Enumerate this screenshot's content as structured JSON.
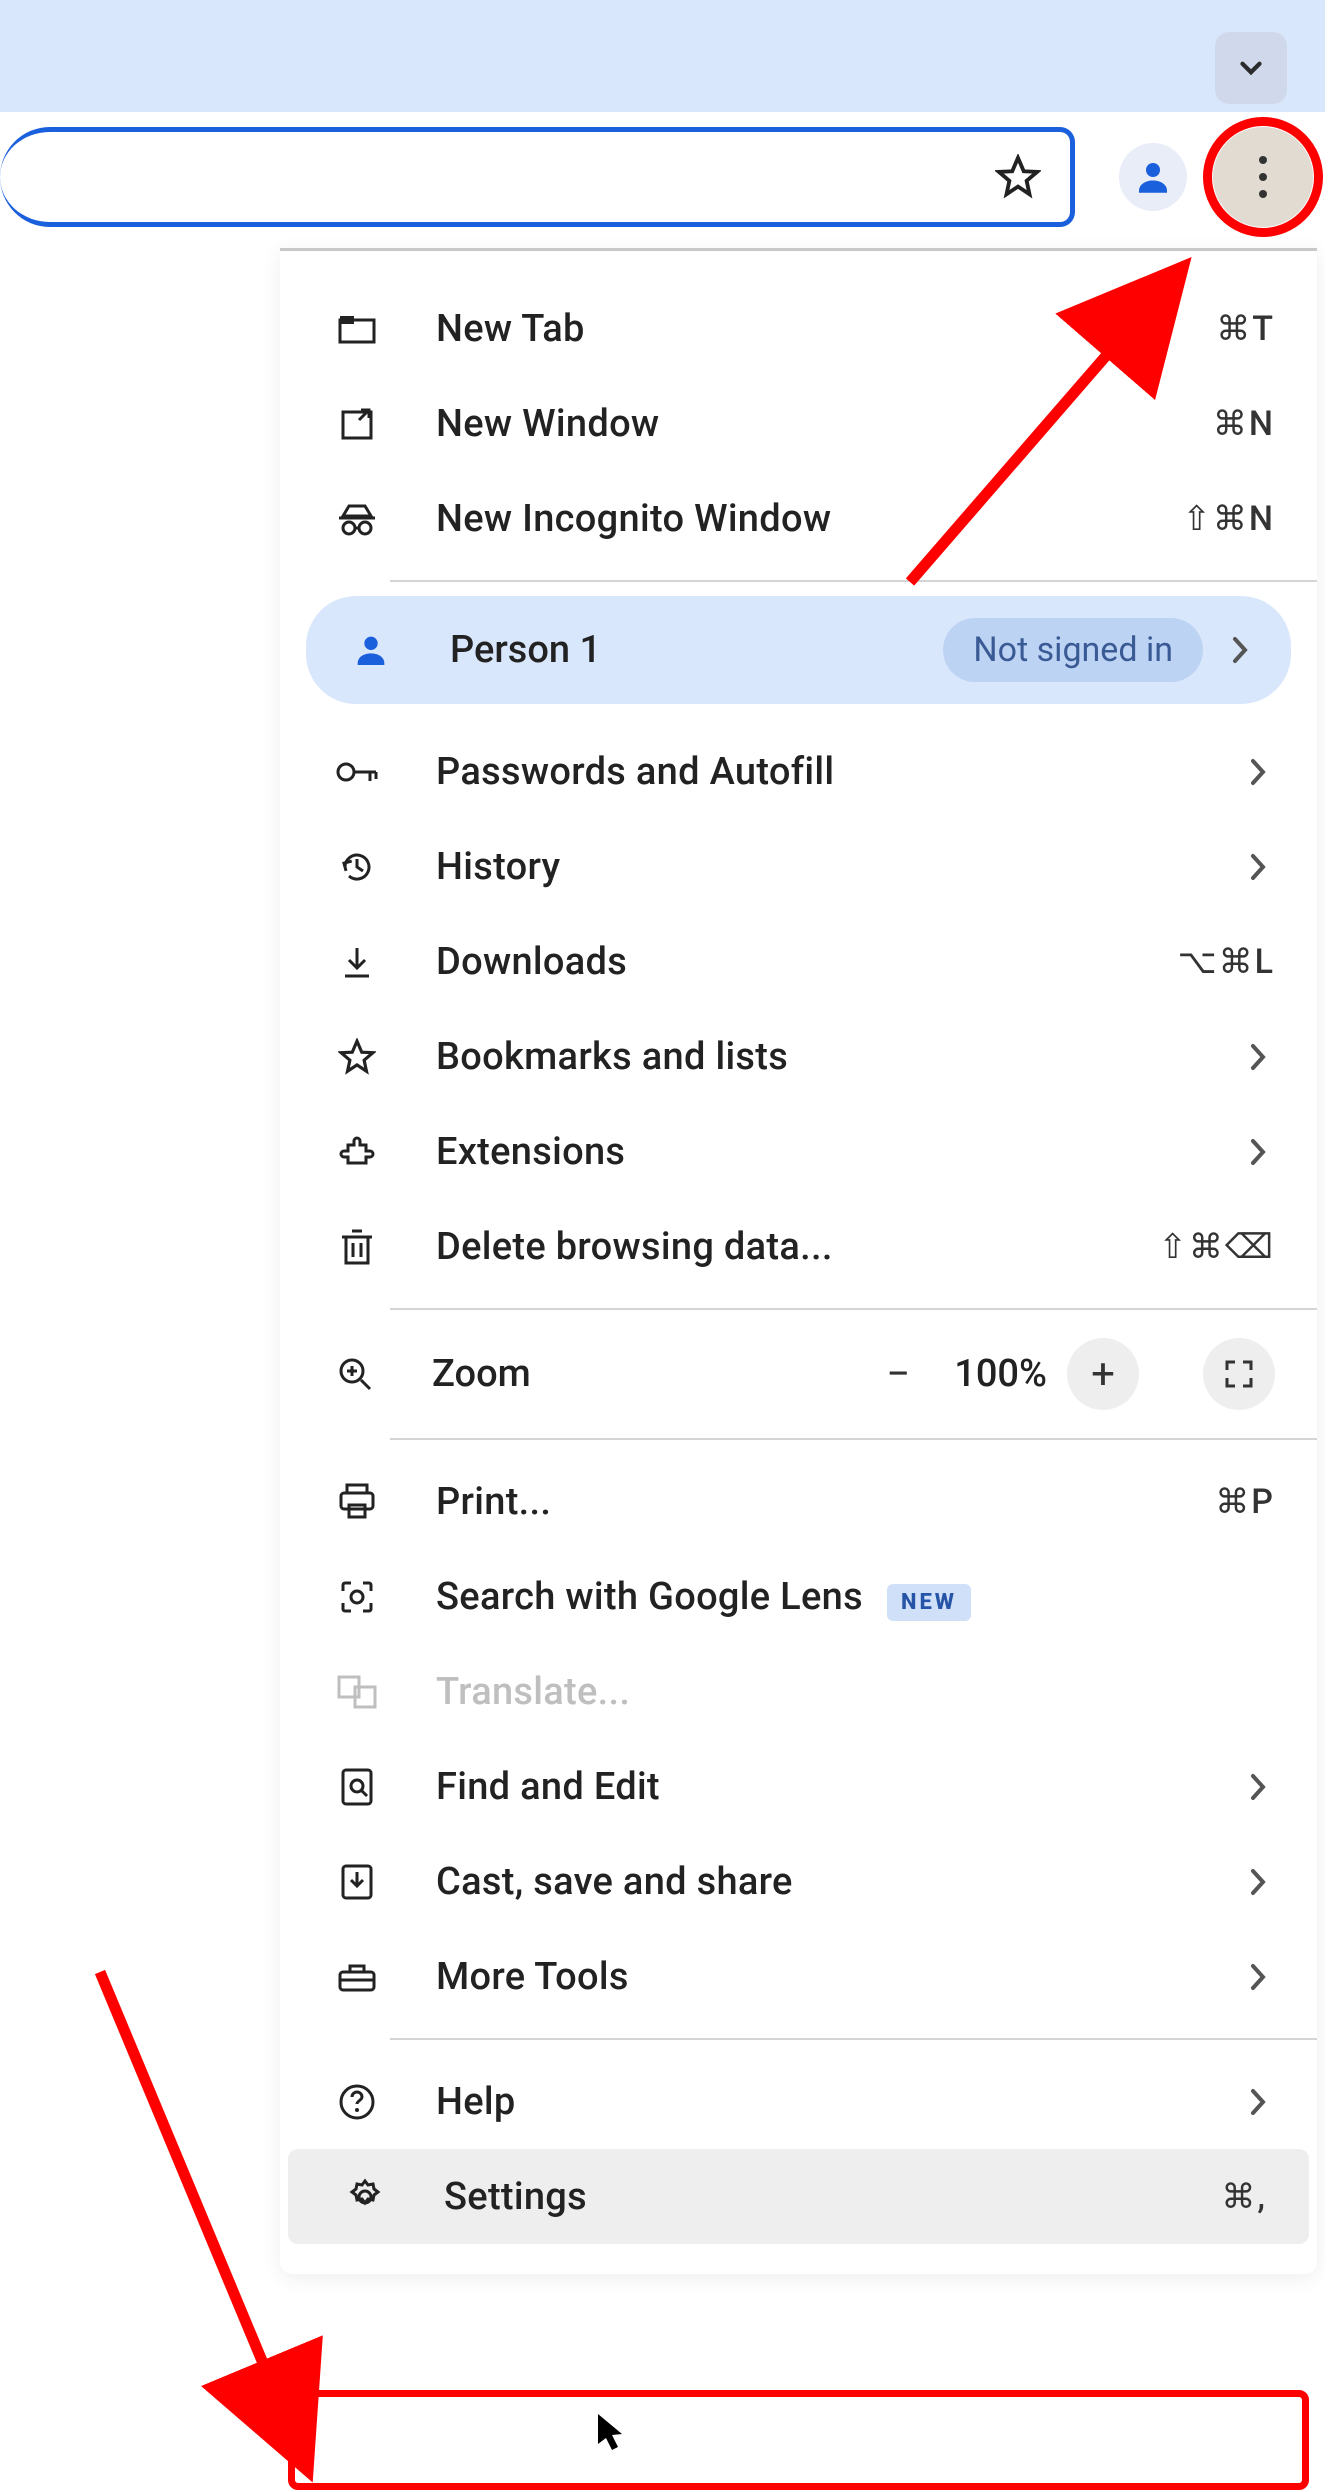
{
  "toolbar": {
    "chevron_icon": "chevron-down"
  },
  "profile": {
    "name": "Person 1",
    "status": "Not signed in"
  },
  "menu": {
    "new_tab": "New Tab",
    "new_tab_sc": "⌘T",
    "new_window": "New Window",
    "new_window_sc": "⌘N",
    "incognito": "New Incognito Window",
    "incognito_sc": "⇧⌘N",
    "passwords": "Passwords and Autofill",
    "history": "History",
    "downloads": "Downloads",
    "downloads_sc": "⌥⌘L",
    "bookmarks": "Bookmarks and lists",
    "extensions": "Extensions",
    "delete_data": "Delete browsing data...",
    "delete_data_sc": "⇧⌘⌫",
    "zoom": "Zoom",
    "zoom_val": "100%",
    "print": "Print...",
    "print_sc": "⌘P",
    "lens": "Search with Google Lens",
    "lens_badge": "NEW",
    "translate": "Translate...",
    "find": "Find and Edit",
    "cast": "Cast, save and share",
    "more_tools": "More Tools",
    "help": "Help",
    "settings": "Settings",
    "settings_sc": "⌘,"
  }
}
